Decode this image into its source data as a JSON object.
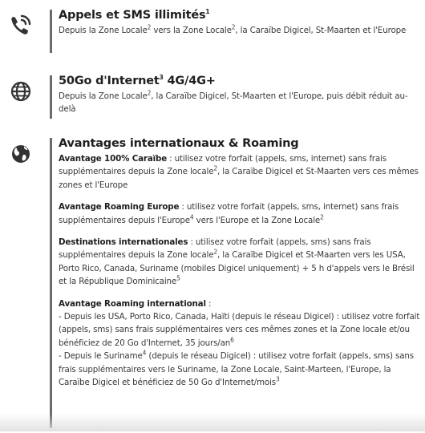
{
  "colors": {
    "text": "#2b2b2b",
    "title": "#1f1f1f",
    "icon": "#333333",
    "accent_bar": "#6b6b6b"
  },
  "features": [
    {
      "icon": "phone-wifi-icon",
      "title": "Appels et SMS illimités",
      "title_sup": "1",
      "desc_parts": [
        "Depuis la Zone Locale",
        "2",
        " vers la Zone Locale",
        "2",
        ", la Caraïbe Digicel, St-Maarten et l'Europe"
      ]
    },
    {
      "icon": "globe-icon",
      "title": "50Go d'Internet",
      "title_sup": "3",
      "title_suffix": " 4G/4G+",
      "desc_parts": [
        "Depuis la Zone Locale",
        "2",
        ", la Caraïbe Digicel, St-Maarten et l'Europe, puis débit réduit au-delà"
      ]
    },
    {
      "icon": "earth-icon",
      "title": "Avantages internationaux & Roaming",
      "paragraphs": [
        {
          "bold": "Avantage 100% Caraïbe",
          "parts": [
            " : utilisez votre forfait (appels, sms, internet) sans frais supplémentaires depuis la Zone locale",
            "2",
            ", la Caraïbe Digicel et St-Maarten vers ces mêmes zones et l'Europe"
          ]
        },
        {
          "bold": "Avantage Roaming Europe",
          "parts": [
            " : utilisez votre forfait (appels, sms, internet) sans frais supplémentaires depuis l'Europe",
            "4",
            "  vers l'Europe et la Zone Locale",
            "2"
          ]
        },
        {
          "bold": "Destinations internationales",
          "parts": [
            " : utilisez votre forfait (appels, sms) sans frais supplémentaires depuis la Zone locale",
            "2",
            ", la Caraïbe Digicel et St-Maarten vers les USA, Porto Rico, Canada, Suriname (mobiles Digicel uniquement) + 5 h d'appels vers le Brésil et la République Dominicaine",
            "5"
          ]
        },
        {
          "bold": "Avantage Roaming international",
          "parts": [
            " :"
          ],
          "lines": [
            [
              "- Depuis les USA, Porto Rico, Canada, Haïti (depuis le réseau Digicel) : utilisez votre forfait (appels, sms) sans frais supplémentaires vers ces mêmes zones et la Zone locale et/ou bénéficiez de 20 Go d'Internet, 35 jours/an",
              "6"
            ],
            [
              "- Depuis le Suriname",
              "4",
              " (depuis le réseau Digicel) : utilisez votre forfait (appels, sms) sans frais supplémentaires vers le Suriname, la Zone Locale, Saint-Marteen, l'Europe, la Caraïbe Digicel et bénéficiez de 50 Go d'Internet/mois",
              "3"
            ]
          ]
        }
      ]
    }
  ]
}
